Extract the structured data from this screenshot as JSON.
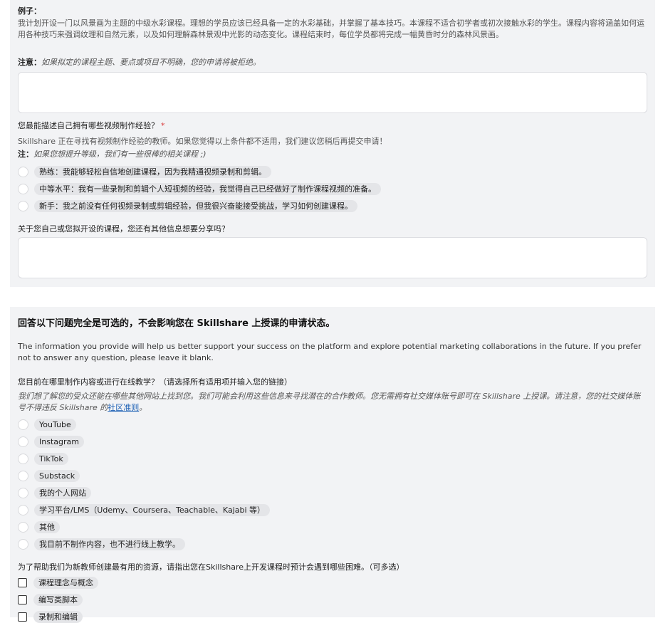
{
  "section1": {
    "example_label": "例子：",
    "example_text": "我计划开设一门以风景画为主题的中级水彩课程。理想的学员应该已经具备一定的水彩基础，并掌握了基本技巧。本课程不适合初学者或初次接触水彩的学生。课程内容将涵盖如何运用各种技巧来强调纹理和自然元素，以及如何理解森林景观中光影的动态变化。课程结束时，每位学员都将完成一幅黄昏时分的森林风景画。",
    "note_label": "注意：",
    "note_text": "如果拟定的课程主题、要点或项目不明确，您的申请将被拒绝。",
    "video_question": "您最能描述自己拥有哪些视频制作经验？",
    "required_mark": "*",
    "video_desc": "Skillshare 正在寻找有视频制作经验的教师。如果您觉得以上条件都不适用，我们建议您稍后再提交申请！",
    "video_note_label": "注：",
    "video_note_text": "如果您想提升等级，我们有一些很棒的相关课程 ;)",
    "video_options": [
      "熟练：我能够轻松自信地创建课程，因为我精通视频录制和剪辑。",
      "中等水平：我有一些录制和剪辑个人短视频的经验，我觉得自己已经做好了制作课程视频的准备。",
      "新手：我之前没有任何视频录制或剪辑经验，但我很兴奋能接受挑战，学习如何创建课程。"
    ],
    "extra_question": "关于您自己或您拟开设的课程，您还有其他信息想要分享吗？"
  },
  "section2": {
    "heading": "回答以下问题完全是可选的，不会影响您在 Skillshare 上授课的申请状态。",
    "intro": "The information you provide will help us better support your success on the platform and explore potential marketing collaborations in the future. If you prefer not to answer any question, please leave it blank.",
    "platform_question": "您目前在哪里制作内容或进行在线教学？（请选择所有适用项并输入您的链接）",
    "platform_desc": "我们想了解您的受众还能在哪些其他网站上找到您。我们可能会利用这些信息来寻找潜在的合作教师。您无需拥有社交媒体账号即可在 Skillshare 上授课。请注意，您的社交媒体账号不得违反 Skillshare 的",
    "platform_link": "社区准则",
    "platform_desc_end": "。",
    "platform_options": [
      "YouTube",
      "Instagram",
      "TikTok",
      "Substack",
      "我的个人网站",
      "学习平台/LMS（Udemy、Coursera、Teachable、Kajabi 等）",
      "其他",
      "我目前不制作内容，也不进行线上教学。"
    ],
    "difficulty_question": "为了帮助我们为新教师创建最有用的资源，请指出您在Skillshare上开发课程时预计会遇到哪些困难。（可多选）",
    "difficulty_options": [
      "课程理念与概念",
      "编写类脚本",
      "录制和编辑"
    ]
  }
}
